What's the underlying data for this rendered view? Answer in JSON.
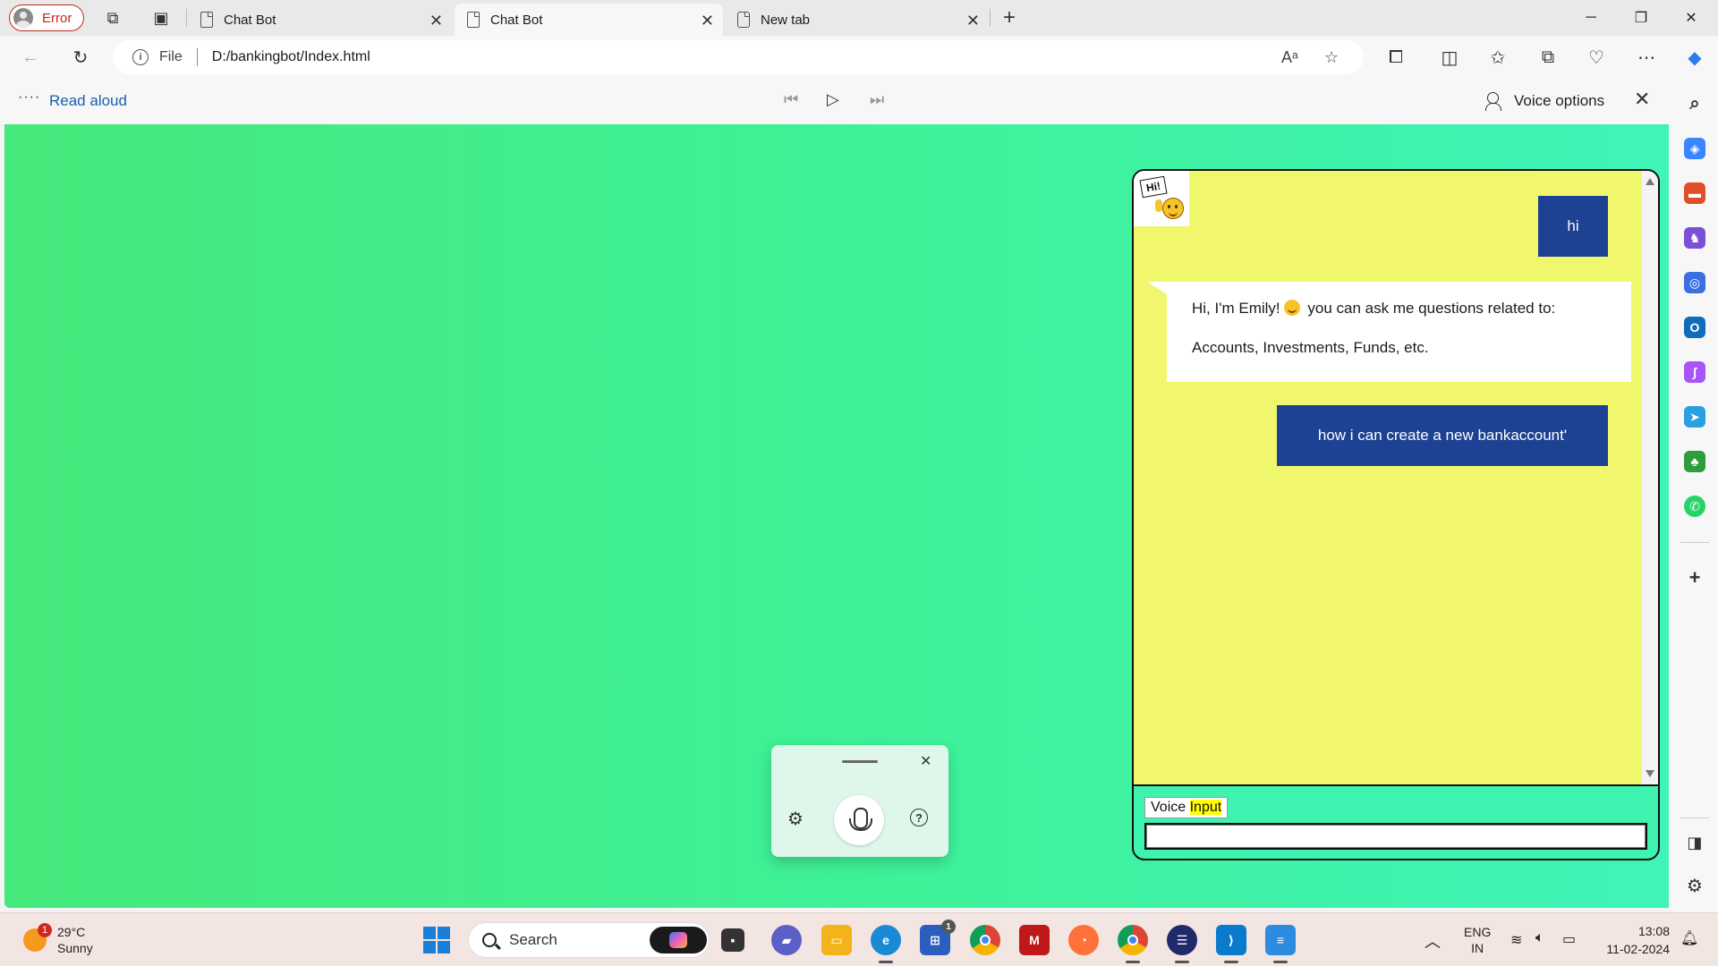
{
  "browser": {
    "profile_label": "Error",
    "tabs": [
      {
        "label": "Chat Bot",
        "active": false
      },
      {
        "label": "Chat Bot",
        "active": true
      },
      {
        "label": "New tab",
        "active": false
      }
    ],
    "address": {
      "scheme_label": "File",
      "url": "D:/bankingbot/Index.html"
    }
  },
  "read_aloud": {
    "label": "Read aloud",
    "voice_options_label": "Voice options"
  },
  "chat": {
    "messages": [
      {
        "role": "user",
        "text": "hi"
      },
      {
        "role": "bot",
        "line1_a": "Hi, I'm Emily!",
        "line1_b": "you can ask me questions related to:",
        "line2": "Accounts, Investments, Funds, etc."
      },
      {
        "role": "user",
        "text": "how i can create a new bankaccount'"
      }
    ],
    "badge_text": "Hi!",
    "voice_label_a": "Voice",
    "voice_label_b": "Input",
    "input_value": ""
  },
  "taskbar": {
    "weather_temp": "29°C",
    "weather_desc": "Sunny",
    "weather_badge": "1",
    "search_label": "Search",
    "lang_top": "ENG",
    "lang_bottom": "IN",
    "time": "13:08",
    "date": "11-02-2024",
    "store_badge": "1"
  }
}
